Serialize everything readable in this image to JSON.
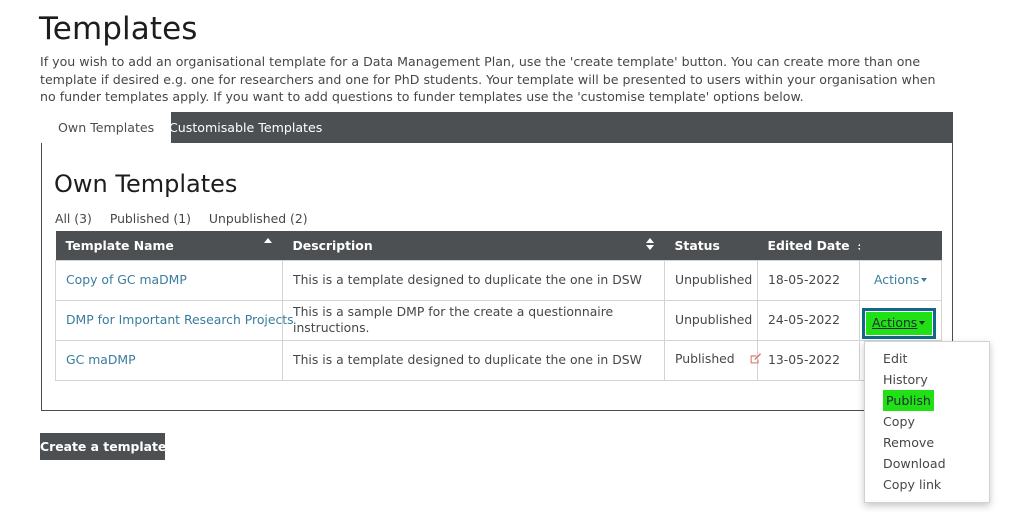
{
  "page": {
    "title": "Templates",
    "intro": "If you wish to add an organisational template for a Data Management Plan, use the 'create template' button. You can create more than one template if desired e.g. one for researchers and one for PhD students. Your template will be presented to users within your organisation when no funder templates apply. If you want to add questions to funder templates use the 'customise template' options below."
  },
  "tabs": [
    {
      "label": "Own Templates",
      "active": true
    },
    {
      "label": "Customisable Templates",
      "active": false
    }
  ],
  "panel": {
    "heading": "Own Templates",
    "filters": [
      {
        "label": "All (3)"
      },
      {
        "label": "Published (1)"
      },
      {
        "label": "Unpublished (2)"
      }
    ]
  },
  "table": {
    "headers": [
      {
        "label": "Template Name",
        "sort": "asc"
      },
      {
        "label": "Description",
        "sort": "both"
      },
      {
        "label": "Status",
        "sort": "none"
      },
      {
        "label": "Edited Date",
        "sort": "both"
      },
      {
        "label": "",
        "sort": "none"
      }
    ],
    "rows": [
      {
        "name": "Copy of GC maDMP",
        "description": "This is a template designed to duplicate the one in DSW",
        "status": "Unpublished",
        "status_icon": "",
        "edited_date": "18-05-2022",
        "actions_label": "Actions",
        "highlighted": false
      },
      {
        "name": "DMP for Important Research Projects",
        "description": "This is a sample DMP for the create a questionnaire instructions.",
        "status": "Unpublished",
        "status_icon": "",
        "edited_date": "24-05-2022",
        "actions_label": "Actions",
        "highlighted": true
      },
      {
        "name": "GC maDMP",
        "description": "This is a template designed to duplicate the one in DSW",
        "status": "Published",
        "status_icon": "pencil-square-icon",
        "edited_date": "13-05-2022",
        "actions_label": "Actions",
        "highlighted": false
      }
    ]
  },
  "dropdown": {
    "open_for_row": 2,
    "items": [
      {
        "label": "Edit",
        "highlighted": false
      },
      {
        "label": "History",
        "highlighted": false
      },
      {
        "label": "Publish",
        "highlighted": true
      },
      {
        "label": "Copy",
        "highlighted": false
      },
      {
        "label": "Remove",
        "highlighted": false
      },
      {
        "label": "Download",
        "highlighted": false
      },
      {
        "label": "Copy link",
        "highlighted": false
      }
    ]
  },
  "footer": {
    "create_button": "Create a template"
  },
  "colors": {
    "dark_bar": "#4d5052",
    "link": "#3b7c9e",
    "highlight_green": "#22e016",
    "highlight_border": "#0e6986",
    "pencil_icon": "#d9706b"
  }
}
